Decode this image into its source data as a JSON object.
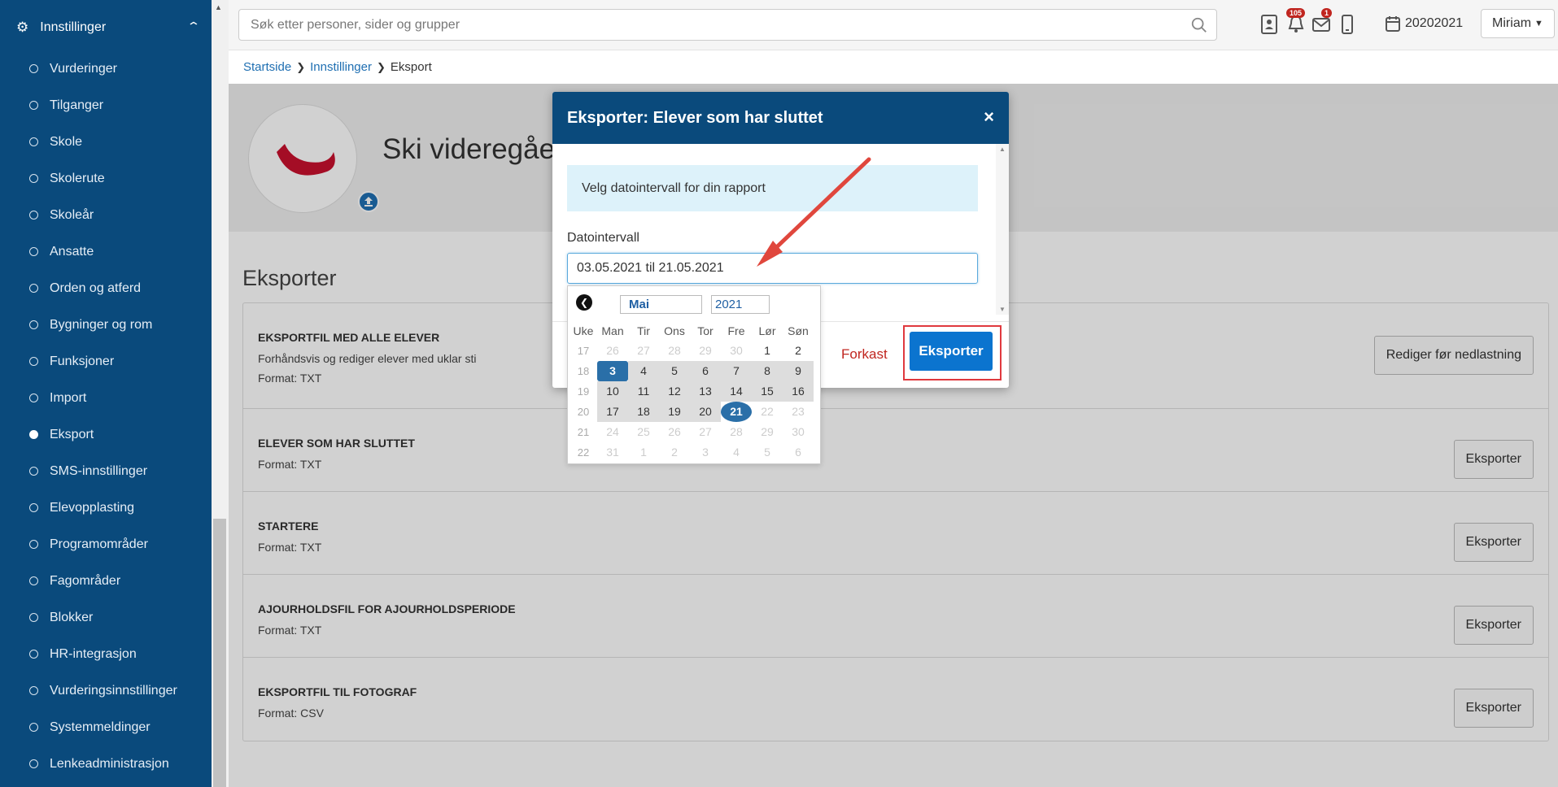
{
  "sidebar": {
    "header": "Innstillinger",
    "items": [
      {
        "label": "Vurderinger"
      },
      {
        "label": "Tilganger"
      },
      {
        "label": "Skole"
      },
      {
        "label": "Skolerute"
      },
      {
        "label": "Skoleår"
      },
      {
        "label": "Ansatte"
      },
      {
        "label": "Orden og atferd"
      },
      {
        "label": "Bygninger og rom"
      },
      {
        "label": "Funksjoner"
      },
      {
        "label": "Import"
      },
      {
        "label": "Eksport",
        "active": true
      },
      {
        "label": "SMS-innstillinger"
      },
      {
        "label": "Elevopplasting"
      },
      {
        "label": "Programområder"
      },
      {
        "label": "Fagområder"
      },
      {
        "label": "Blokker"
      },
      {
        "label": "HR-integrasjon"
      },
      {
        "label": "Vurderingsinnstillinger"
      },
      {
        "label": "Systemmeldinger"
      },
      {
        "label": "Lenkeadministrasjon"
      }
    ]
  },
  "topbar": {
    "search_placeholder": "Søk etter personer, sider og grupper",
    "notifications_count": "105",
    "messages_count": "1",
    "school_year": "20202021",
    "user": "Miriam"
  },
  "breadcrumb": {
    "home": "Startside",
    "settings": "Innstillinger",
    "current": "Eksport"
  },
  "school": {
    "name": "Ski videregåe"
  },
  "main": {
    "title": "Eksporter",
    "rows": [
      {
        "title": "EKSPORTFIL MED ALLE ELEVER",
        "desc": "Forhåndsvis og rediger elever med uklar sti",
        "format": "Format: TXT",
        "button": "Rediger før nedlastning"
      },
      {
        "title": "ELEVER SOM HAR SLUTTET",
        "format": "Format: TXT",
        "button": "Eksporter"
      },
      {
        "title": "STARTERE",
        "format": "Format: TXT",
        "button": "Eksporter"
      },
      {
        "title": "AJOURHOLDSFIL FOR AJOURHOLDSPERIODE",
        "format": "Format: TXT",
        "button": "Eksporter"
      },
      {
        "title": "EKSPORTFIL TIL FOTOGRAF",
        "format": "Format: CSV",
        "button": "Eksporter"
      }
    ]
  },
  "modal": {
    "title": "Eksporter: Elever som har sluttet",
    "close": "×",
    "info": "Velg datointervall for din rapport",
    "field_label": "Datointervall",
    "field_value": "03.05.2021 til 21.05.2021",
    "cancel": "Forkast",
    "export": "Eksporter"
  },
  "calendar": {
    "month": "Mai",
    "year": "2021",
    "headers": [
      "Uke",
      "Man",
      "Tir",
      "Ons",
      "Tor",
      "Fre",
      "Lør",
      "Søn"
    ],
    "weeks": [
      {
        "wk": "17",
        "days": [
          "26",
          "27",
          "28",
          "29",
          "30",
          "1",
          "2"
        ]
      },
      {
        "wk": "18",
        "days": [
          "3",
          "4",
          "5",
          "6",
          "7",
          "8",
          "9"
        ]
      },
      {
        "wk": "19",
        "days": [
          "10",
          "11",
          "12",
          "13",
          "14",
          "15",
          "16"
        ]
      },
      {
        "wk": "20",
        "days": [
          "17",
          "18",
          "19",
          "20",
          "21",
          "22",
          "23"
        ]
      },
      {
        "wk": "21",
        "days": [
          "24",
          "25",
          "26",
          "27",
          "28",
          "29",
          "30"
        ]
      },
      {
        "wk": "22",
        "days": [
          "31",
          "1",
          "2",
          "3",
          "4",
          "5",
          "6"
        ]
      }
    ],
    "range_start": "3",
    "range_end": "21"
  },
  "colors": {
    "sidebar": "#0a4a7c",
    "accent": "#0b74cf",
    "danger": "#c0251f",
    "highlight": "#e0393e"
  }
}
